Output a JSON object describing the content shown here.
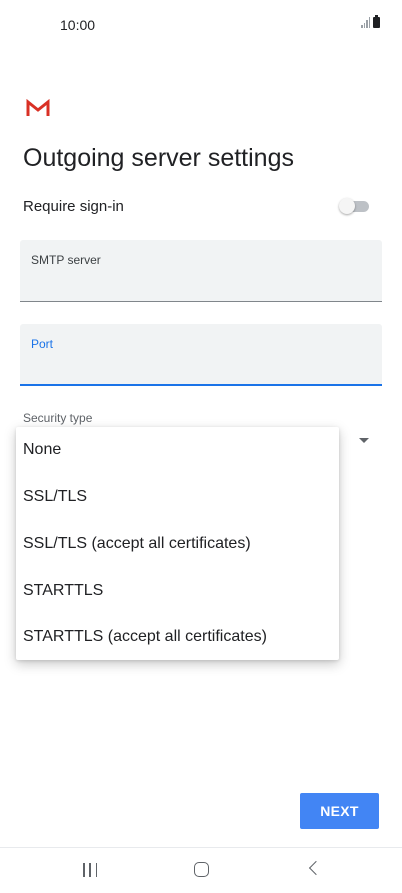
{
  "status_bar": {
    "time": "10:00",
    "icons": [
      "signal-icon",
      "battery-icon"
    ]
  },
  "header": {
    "app_icon": "gmail-icon",
    "title": "Outgoing server settings"
  },
  "require_signin": {
    "label": "Require sign-in",
    "enabled": false
  },
  "fields": {
    "smtp_server": {
      "label": "SMTP server",
      "value": ""
    },
    "port": {
      "label": "Port",
      "value": "",
      "focused": true
    }
  },
  "security": {
    "label": "Security type",
    "options": [
      "None",
      "SSL/TLS",
      "SSL/TLS (accept all certificates)",
      "STARTTLS",
      "STARTTLS (accept all certificates)"
    ]
  },
  "actions": {
    "next_label": "NEXT"
  },
  "nav_bar": {
    "icons": [
      "recents-icon",
      "home-icon",
      "back-icon"
    ]
  },
  "colors": {
    "accent": "#1a73e8",
    "button": "#4285f4",
    "gmail_red": "#d93025",
    "field_bg": "#f1f3f4"
  }
}
